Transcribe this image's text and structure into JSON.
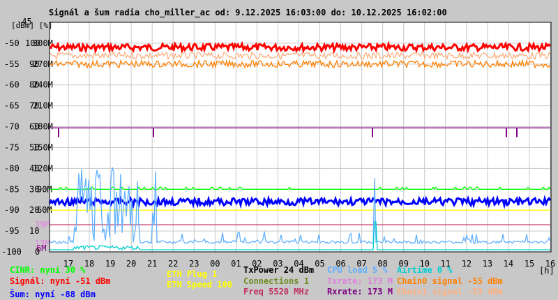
{
  "title": "Signál a šum radia cho_miller_ac od: 9.12.2025 16:03:00 do: 10.12.2025 16:02:00",
  "chart_data": {
    "type": "line",
    "title": "Signál a šum radia cho_miller_ac od: 9.12.2025 16:03:00 do: 10.12.2025 16:02:00",
    "ylabel": "[dBm] [%]",
    "xlabel": "[h]",
    "ylim": [
      -100,
      -45
    ],
    "grid": true,
    "y_ticks": [
      {
        "dbm": "-45",
        "pct": "",
        "rate": ""
      },
      {
        "dbm": "-50",
        "pct": "100",
        "rate": "300M"
      },
      {
        "dbm": "-55",
        "pct": "90",
        "rate": "270M"
      },
      {
        "dbm": "-60",
        "pct": "80",
        "rate": "240M"
      },
      {
        "dbm": "-65",
        "pct": "70",
        "rate": "210M"
      },
      {
        "dbm": "-70",
        "pct": "60",
        "rate": "180M"
      },
      {
        "dbm": "-75",
        "pct": "50",
        "rate": "150M"
      },
      {
        "dbm": "-80",
        "pct": "40",
        "rate": "120M"
      },
      {
        "dbm": "-85",
        "pct": "30",
        "rate": "90M"
      },
      {
        "dbm": "-90",
        "pct": "20",
        "rate": "60M"
      },
      {
        "dbm": "-95",
        "pct": "10",
        "rate": ""
      },
      {
        "dbm": "-100",
        "pct": "0",
        "rate": ""
      }
    ],
    "extra_ticks": [
      {
        "label": "39M",
        "color": "#e080e0",
        "value_dbm": -93.5
      },
      {
        "label": "13M",
        "color": "#e080e0",
        "value_dbm": -98
      },
      {
        "label": "6M",
        "color": "#800080",
        "value_dbm": -99.2
      }
    ],
    "x_ticks": [
      "17",
      "18",
      "19",
      "20",
      "21",
      "22",
      "23",
      "00",
      "01",
      "02",
      "03",
      "04",
      "05",
      "06",
      "07",
      "08",
      "09",
      "10",
      "11",
      "12",
      "13",
      "14",
      "15",
      "16"
    ],
    "series": [
      {
        "name": "Signál",
        "color": "#ff0000",
        "level_dbm": -51
      },
      {
        "name": "Chain1 signal",
        "color": "#ffb080",
        "level_dbm": -53
      },
      {
        "name": "Chain0 signal",
        "color": "#ff8000",
        "level_dbm": -55
      },
      {
        "name": "Rxrate",
        "color": "#800080",
        "level_dbm": -70.3
      },
      {
        "name": "CINR",
        "color": "#00ff00",
        "level_dbm": -85
      },
      {
        "name": "Šum",
        "color": "#0000ff",
        "level_dbm": -88
      },
      {
        "name": "ETH",
        "color": "#ffff00",
        "level_dbm": -90
      },
      {
        "name": "Freq",
        "color": "#c03060",
        "level_dbm": -93.5
      },
      {
        "name": "CPU load",
        "color": "#60b0ff",
        "level_dbm": -98
      },
      {
        "name": "Airtime",
        "color": "#00d0d0",
        "level_dbm": -99.5
      }
    ]
  },
  "legend": {
    "cinr": "CINR: nyní 30 %",
    "signal": "Signál: nyní -51 dBm",
    "noise": "Šum: nyní -88 dBm",
    "eth_plug": "ETH Plug 1",
    "eth_speed": "ETH Speed 100",
    "txpower": "TxPower 24 dBm",
    "connections": "Connections 1",
    "freq": "Freq 5520 MHz",
    "cpu": "CPU load 5 %",
    "txrate": "Txrate: 173 M",
    "rxrate": "Rxrate: 173 M",
    "airtime": "Airtime 0 %",
    "chain0": "Chain0 signal -55 dBm",
    "chain1": "Chain1 signal -53 dBm"
  },
  "colors": {
    "cinr": "#00ff00",
    "signal": "#ff0000",
    "noise": "#0000ff",
    "eth": "#ffff00",
    "txpower": "#000000",
    "connections": "#6b8e23",
    "freq": "#c03060",
    "cpu": "#60b0ff",
    "txrate": "#e080e0",
    "rxrate": "#800080",
    "airtime": "#00d0d0",
    "chain0": "#ff8000",
    "chain1": "#ffb080"
  }
}
